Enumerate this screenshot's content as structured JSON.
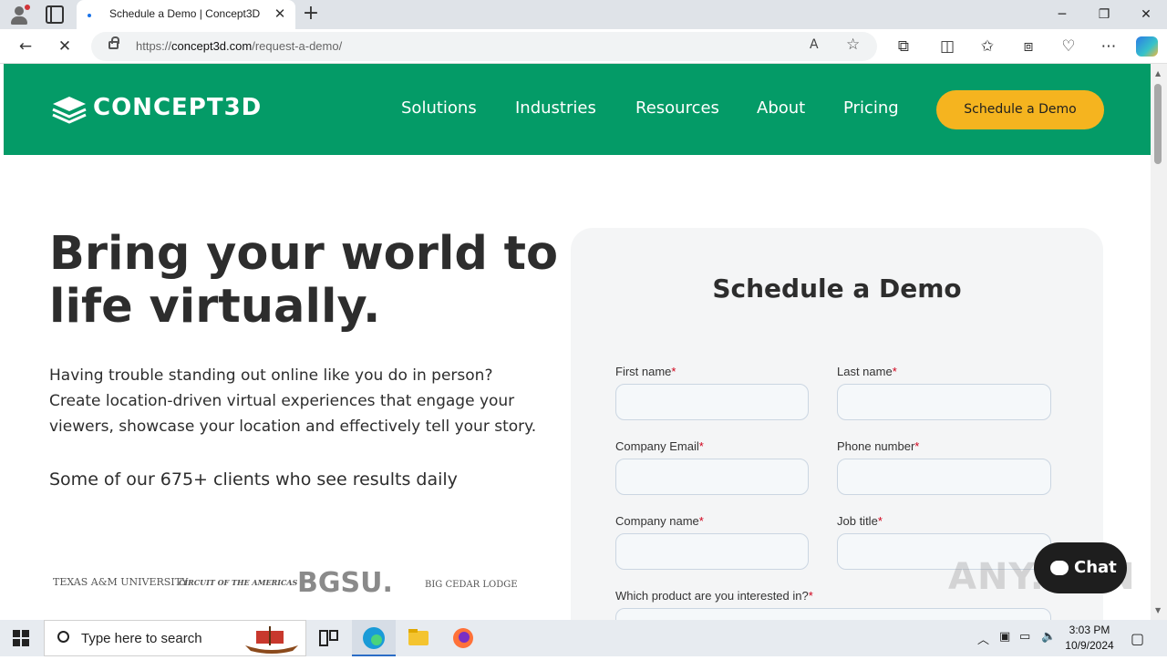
{
  "browser": {
    "tab_title": "Schedule a Demo | Concept3D",
    "url_domain": "concept3d.com",
    "url_prefix": "https://",
    "url_path": "/request-a-demo/"
  },
  "site": {
    "logo_text": "CONCEPT3D",
    "nav": [
      "Solutions",
      "Industries",
      "Resources",
      "About",
      "Pricing"
    ],
    "cta_label": "Schedule a Demo",
    "brand_color": "#049b67",
    "cta_color": "#f5b41f"
  },
  "hero": {
    "title": "Bring your world to life virtually.",
    "text": "Having trouble standing out online like you do in person? Create location-driven virtual experiences that engage your viewers, showcase your location and effectively tell your story.",
    "clients_heading": "Some of our 675+ clients who see results daily",
    "client_logos": [
      "TEXAS A&M UNIVERSITY",
      "CIRCUIT OF THE AMERICAS",
      "BGSU.",
      "BIG CEDAR LODGE"
    ]
  },
  "form": {
    "title": "Schedule a Demo",
    "fields": {
      "first_name": "First name",
      "last_name": "Last name",
      "company_email": "Company Email",
      "phone": "Phone number",
      "company_name": "Company name",
      "job_title": "Job title",
      "product": "Which product are you interested in?"
    },
    "required_mark": "*"
  },
  "chat": {
    "label": "Chat"
  },
  "watermark": "ANY.RUN",
  "taskbar": {
    "search_placeholder": "Type here to search",
    "time": "3:03 PM",
    "date": "10/9/2024"
  }
}
